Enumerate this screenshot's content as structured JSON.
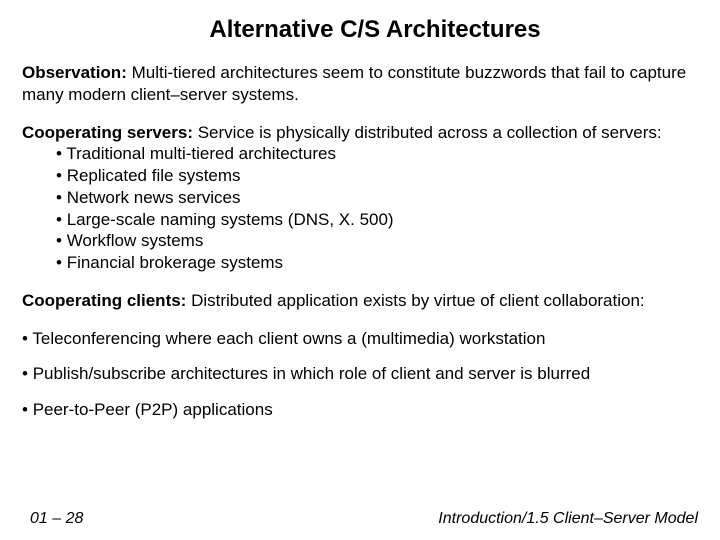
{
  "title": "Alternative C/S Architectures",
  "observation": {
    "lead": "Observation:",
    "text": " Multi-tiered architectures seem to constitute buzzwords that fail to capture many modern client–server systems."
  },
  "coop_servers": {
    "lead": "Cooperating servers:",
    "text": " Service is physically distributed across a collection of servers:",
    "items": [
      "Traditional multi-tiered architectures",
      "Replicated file systems",
      "Network news services",
      "Large-scale naming systems (DNS, X. 500)",
      "Workflow systems",
      "Financial brokerage systems"
    ]
  },
  "coop_clients": {
    "lead": "Cooperating clients:",
    "text": " Distributed application exists by virtue of client collaboration:",
    "items": [
      "Teleconferencing where each client owns a (multimedia) workstation",
      "Publish/subscribe architectures in which role of client and server is blurred",
      "Peer-to-Peer (P2P) applications"
    ]
  },
  "footer": {
    "left": "01 – 28",
    "right": "Introduction/1.5 Client–Server Model"
  }
}
